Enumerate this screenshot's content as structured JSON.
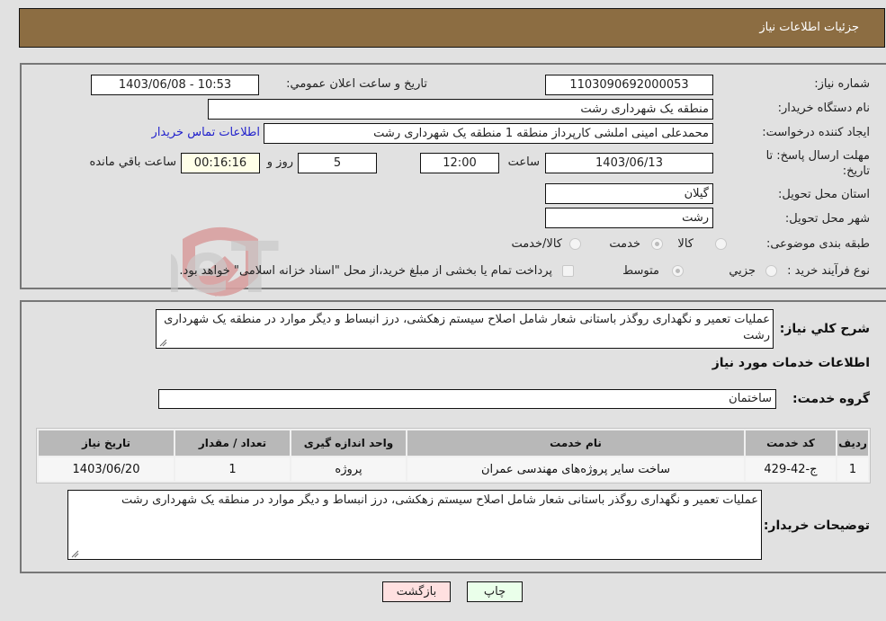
{
  "header": {
    "title": "جزئیات اطلاعات نیاز"
  },
  "fields": {
    "need_number_label": "شماره نیاز:",
    "need_number": "1103090692000053",
    "announce_label": "تاریخ و ساعت اعلان عمومي:",
    "announce_value": "1403/06/08 - 10:53",
    "buyer_org_label": "نام دستگاه خریدار:",
    "buyer_org": "منطقه یک شهرداری رشت",
    "creator_label": "ایجاد کننده درخواست:",
    "creator": "محمدعلی امینی املشی کارپرداز منطقه 1 منطقه یک شهرداری رشت",
    "contact_link": "اطلاعات تماس خریدار",
    "deadline_label_line1": "مهلت ارسال پاسخ: تا",
    "deadline_label_line2": "تاریخ:",
    "deadline_date": "1403/06/13",
    "time_label": "ساعت",
    "deadline_time": "12:00",
    "days_value": "5",
    "days_label": "روز و",
    "remaining_time": "00:16:16",
    "remaining_label": "ساعت باقي مانده",
    "province_label": "استان محل تحویل:",
    "province": "گیلان",
    "city_label": "شهر محل تحویل:",
    "city": "رشت",
    "category_label": "طبقه بندی موضوعی:",
    "category_options": [
      "کالا",
      "خدمت",
      "کالا/خدمت"
    ],
    "category_selected": "خدمت",
    "process_label": "نوع فرآیند خرید :",
    "process_options": [
      "جزيي",
      "متوسط"
    ],
    "process_selected": "متوسط",
    "treasury_note": "پرداخت تمام یا بخشی از مبلغ خرید،از محل \"اسناد خزانه اسلامی\" خواهد بود."
  },
  "description": {
    "label": "شرح کلي نیاز:",
    "text": "عملیات تعمیر و نگهداری روگذر باستانی شعار شامل اصلاح سیستم زهکشی، درز انبساط و دیگر موارد در منطقه یک شهرداری رشت"
  },
  "services": {
    "section_title": "اطلاعات خدمات مورد نیاز",
    "group_label": "گروه خدمت:",
    "group_value": "ساختمان",
    "table": {
      "headers": [
        "ردیف",
        "کد خدمت",
        "نام خدمت",
        "واحد اندازه گیری",
        "تعداد / مقدار",
        "تاریخ نیاز"
      ],
      "rows": [
        [
          "1",
          "ج-42-429",
          "ساخت سایر پروژه‌های مهندسی عمران",
          "پروژه",
          "1",
          "1403/06/20"
        ]
      ]
    }
  },
  "buyer_notes": {
    "label": "توضیحات خریدار:",
    "text": "عملیات تعمیر و نگهداری روگذر باستانی شعار شامل اصلاح سیستم زهکشی، درز انبساط و دیگر موارد در منطقه یک شهرداری رشت"
  },
  "buttons": {
    "print": "چاپ",
    "back": "بازگشت"
  },
  "watermark": {
    "text": "AriaTender.neT"
  }
}
